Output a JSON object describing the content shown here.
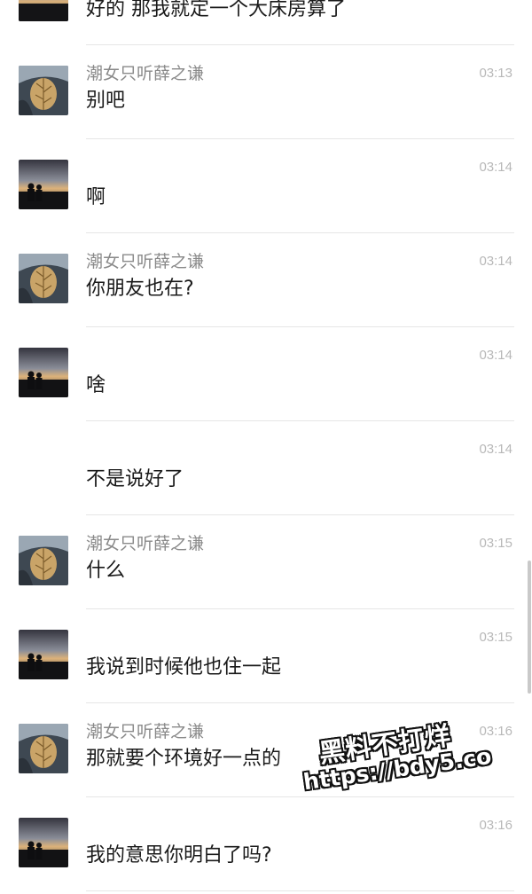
{
  "contact_name": "潮女只听薛之谦",
  "messages": [
    {
      "sender": "self",
      "show_name": false,
      "time": "",
      "text": "好的  那我就定一个大床房算了",
      "avatar": "sunset-avatar"
    },
    {
      "sender": "other",
      "show_name": true,
      "time": "03:13",
      "text": "别吧",
      "avatar": "leaf-avatar"
    },
    {
      "sender": "self",
      "show_name": false,
      "time": "03:14",
      "text": "啊",
      "avatar": "sunset-avatar"
    },
    {
      "sender": "other",
      "show_name": true,
      "time": "03:14",
      "text": "你朋友也在?",
      "avatar": "leaf-avatar"
    },
    {
      "sender": "self",
      "show_name": false,
      "time": "03:14",
      "text": "啥",
      "avatar": "sunset-avatar"
    },
    {
      "sender": "self",
      "show_name": false,
      "time": "03:14",
      "text": "不是说好了",
      "avatar": "none"
    },
    {
      "sender": "other",
      "show_name": true,
      "time": "03:15",
      "text": "什么",
      "avatar": "leaf-avatar"
    },
    {
      "sender": "self",
      "show_name": false,
      "time": "03:15",
      "text": "我说到时候他也住一起",
      "avatar": "sunset-avatar"
    },
    {
      "sender": "other",
      "show_name": true,
      "time": "03:16",
      "text": "那就要个环境好一点的",
      "avatar": "leaf-avatar"
    },
    {
      "sender": "self",
      "show_name": false,
      "time": "03:16",
      "text": "我的意思你明白了吗?",
      "avatar": "sunset-avatar"
    }
  ],
  "watermark": {
    "line1": "黑料不打烊",
    "line2": "https://bdy5.co"
  },
  "colors": {
    "name_text": "#8a8a8a",
    "time_text": "#b8b8b8",
    "message_text": "#1a1a1a",
    "divider": "#e6e6e6"
  }
}
